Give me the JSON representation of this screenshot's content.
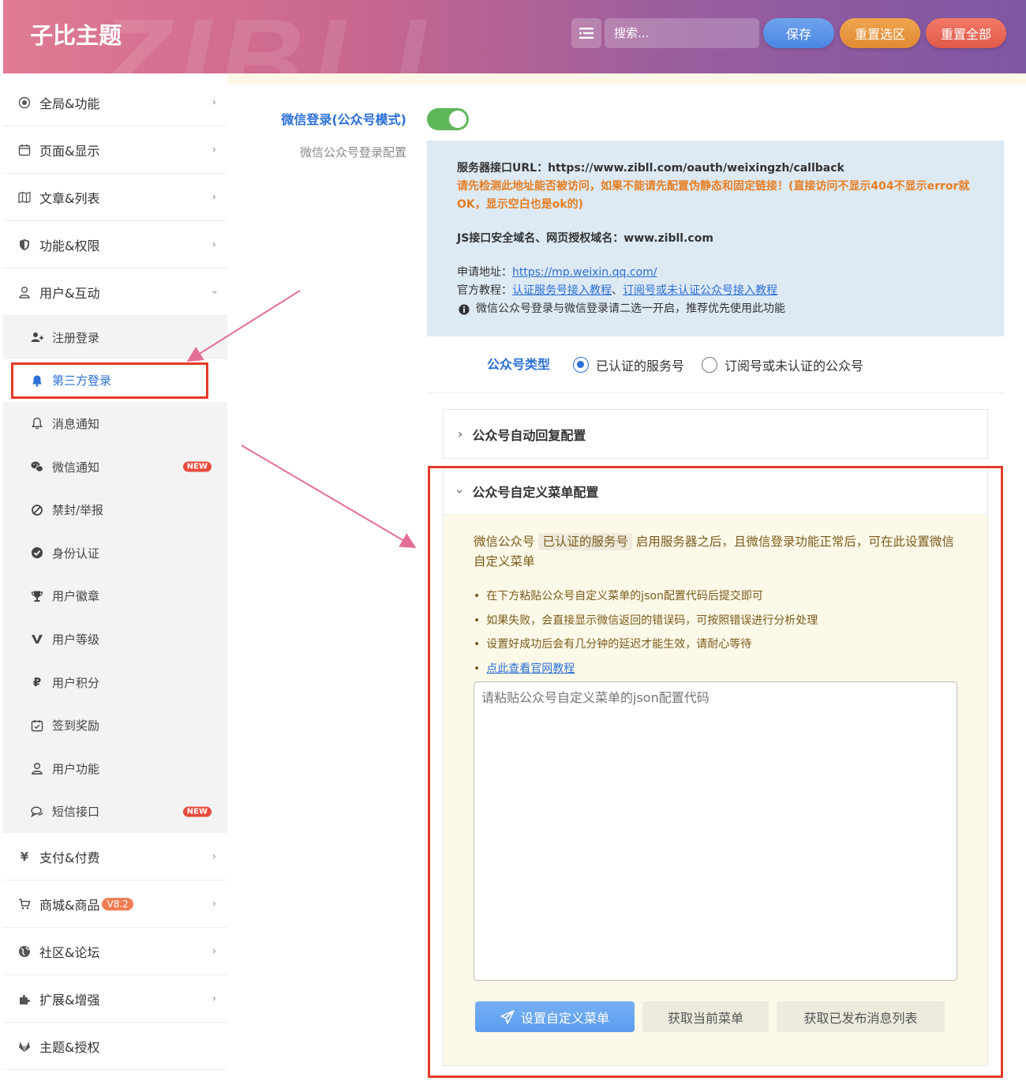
{
  "header": {
    "brand": "子比主题",
    "watermark": "ZIBLL",
    "search_placeholder": "搜索...",
    "save_label": "保存",
    "reset_section_label": "重置选区",
    "reset_all_label": "重置全部"
  },
  "sidebar": {
    "top_items": [
      {
        "label": "全局&功能",
        "icon": "target-icon"
      },
      {
        "label": "页面&显示",
        "icon": "calendar-icon"
      },
      {
        "label": "文章&列表",
        "icon": "map-icon"
      },
      {
        "label": "功能&权限",
        "icon": "shield-icon"
      },
      {
        "label": "用户&互动",
        "icon": "user-icon"
      }
    ],
    "sub_items": [
      {
        "label": "注册登录",
        "icon": "user-plus-icon"
      },
      {
        "label": "第三方登录",
        "icon": "bell-filled-icon"
      },
      {
        "label": "消息通知",
        "icon": "bell-icon"
      },
      {
        "label": "微信通知",
        "icon": "wechat-icon",
        "badge": "NEW"
      },
      {
        "label": "禁封/举报",
        "icon": "ban-icon"
      },
      {
        "label": "身份认证",
        "icon": "check-circle-icon"
      },
      {
        "label": "用户徽章",
        "icon": "trophy-icon"
      },
      {
        "label": "用户等级",
        "icon": "v-icon"
      },
      {
        "label": "用户积分",
        "icon": "ruble-icon"
      },
      {
        "label": "签到奖励",
        "icon": "calendar-check-icon"
      },
      {
        "label": "用户功能",
        "icon": "user-icon"
      },
      {
        "label": "短信接口",
        "icon": "chat-icon",
        "badge": "NEW"
      }
    ],
    "bottom_items": [
      {
        "label": "支付&付费",
        "icon": "yen-icon"
      },
      {
        "label": "商城&商品",
        "icon": "cart-icon",
        "badge": "V8.2"
      },
      {
        "label": "社区&论坛",
        "icon": "globe-icon"
      },
      {
        "label": "扩展&增强",
        "icon": "puzzle-icon"
      },
      {
        "label": "主题&授权",
        "icon": "gitlab-icon"
      }
    ]
  },
  "main": {
    "wechat_login_label": "微信登录(公众号模式)",
    "wechat_login_sub": "微信公众号登录配置",
    "info": {
      "server_url": "服务器接口URL：https://www.zibll.com/oauth/weixingzh/callback",
      "warn": "请先检测此地址能否被访问，如果不能请先配置伪静态和固定链接！(直接访问不显示404不显示error就OK，显示空白也是ok的)",
      "js_domain": "JS接口安全域名、网页授权域名：www.zibll.com",
      "apply_prefix": "申请地址：",
      "apply_link": "https://mp.weixin.qq.com/",
      "tutorial_prefix": "官方教程：",
      "tutorial_link1": "认证服务号接入教程",
      "tutorial_sep": "、",
      "tutorial_link2": "订阅号或未认证公众号接入教程",
      "note": "微信公众号登录与微信登录请二选一开启，推荐优先使用此功能"
    },
    "account_type": {
      "label": "公众号类型",
      "option1": "已认证的服务号",
      "option2": "订阅号或未认证的公众号"
    },
    "auto_reply_title": "公众号自动回复配置",
    "menu_config": {
      "title": "公众号自定义菜单配置",
      "desc_prefix": "微信公众号",
      "desc_tag": "已认证的服务号",
      "desc_suffix": "启用服务器之后，且微信登录功能正常后，可在此设置微信自定义菜单",
      "tips": [
        "在下方粘贴公众号自定义菜单的json配置代码后提交即可",
        "如果失败，会直接显示微信返回的错误码，可按照错误进行分析处理",
        "设置好成功后会有几分钟的延迟才能生效，请耐心等待"
      ],
      "tutorial_link": "点此查看官网教程",
      "textarea_placeholder": "请粘贴公众号自定义菜单的json配置代码",
      "btn_set": "设置自定义菜单",
      "btn_get": "获取当前菜单",
      "btn_list": "获取已发布消息列表"
    }
  }
}
